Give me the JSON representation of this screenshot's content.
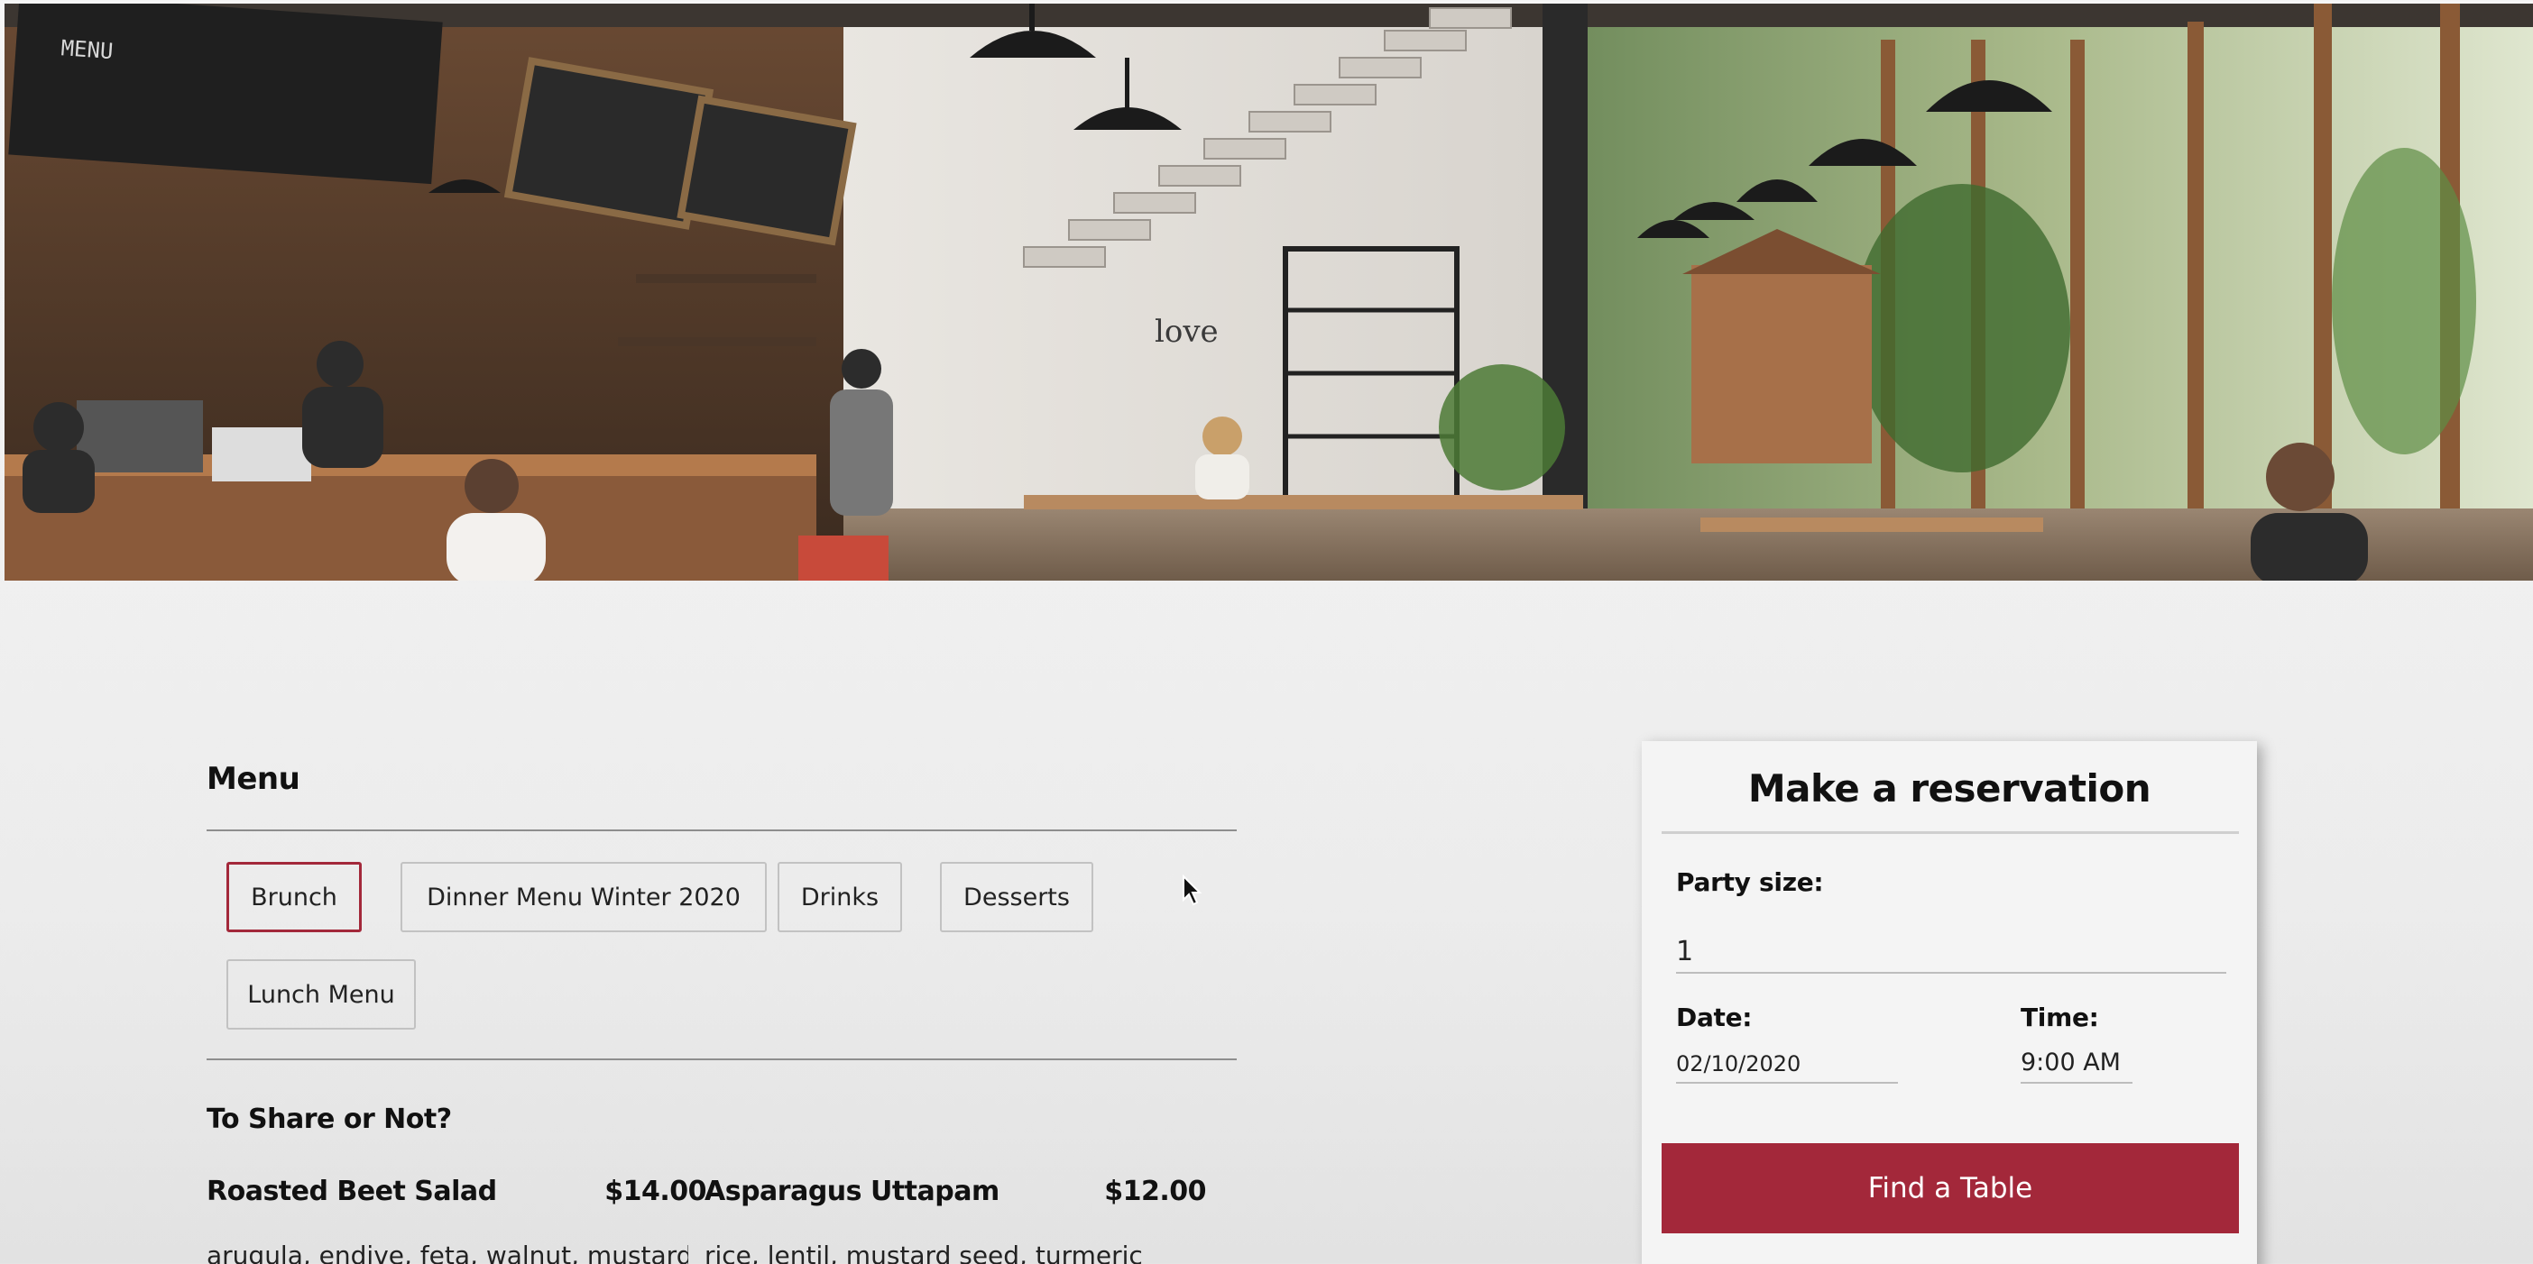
{
  "hero": {
    "image": "restaurant-interior-photo",
    "sign_text": "love"
  },
  "menu": {
    "title": "Menu",
    "tabs": [
      {
        "label": "Brunch",
        "active": true
      },
      {
        "label": "Dinner Menu Winter 2020",
        "active": false
      },
      {
        "label": "Drinks",
        "active": false
      },
      {
        "label": "Desserts",
        "active": false
      },
      {
        "label": "Lunch Menu",
        "active": false
      }
    ],
    "section": "To Share or Not?",
    "items": [
      {
        "name": "Roasted Beet Salad",
        "price": "$14.00",
        "description": "arugula, endive, feta, walnut, mustard"
      },
      {
        "name": "Asparagus Uttapam",
        "price": "$12.00",
        "description": "rice, lentil, mustard seed, turmeric"
      }
    ]
  },
  "reservation": {
    "title": "Make a reservation",
    "party_label": "Party size:",
    "party_value": "1",
    "date_label": "Date:",
    "date_value": "02/10/2020",
    "time_label": "Time:",
    "time_value": "9:00 AM",
    "button_label": "Find a Table"
  },
  "colors": {
    "accent": "#a3283a",
    "button_text": "#ffffff",
    "background": "#efefef"
  }
}
